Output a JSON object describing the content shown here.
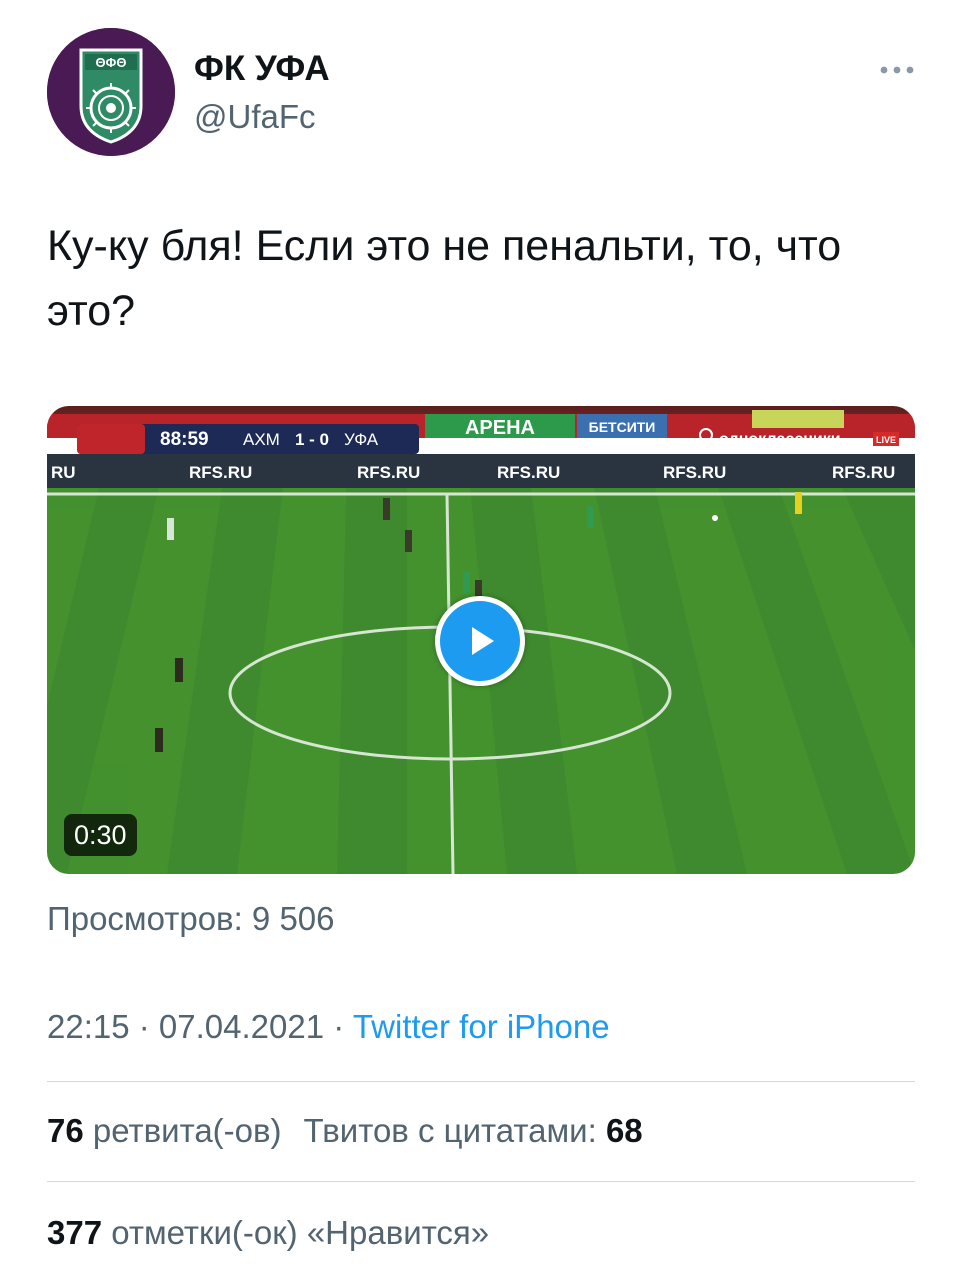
{
  "tweet": {
    "display_name": "ФК УФА",
    "handle": "@UfaFc",
    "text": "Ку-ку бля! Если это не пенальти, то, что это?",
    "views": "Просмотров: 9 506",
    "time": "22:15",
    "date": "07.04.2021",
    "source": "Twitter for iPhone",
    "retweets_count": "76",
    "retweets_label": "ретвита(-ов)",
    "quotes_label": "Твитов с цитатами:",
    "quotes_count": "68",
    "likes_count": "377",
    "likes_label": "отметки(-ок) «Нравится»"
  },
  "video": {
    "duration": "0:30",
    "scoreboard": {
      "time": "88:59",
      "home": "АХМ",
      "score": "1 - 0",
      "away": "УФА"
    },
    "broadcaster": "одноклассники",
    "live": "LIVE",
    "board_text": "RFS.RU",
    "arena_text": "АРЕНА",
    "sponsor_text": "БЕТСИТИ"
  },
  "colors": {
    "accent": "#1d9bf0",
    "secondary_text": "#536471",
    "avatar_bg": "#4a1a54",
    "pitch": "#3f8a2e"
  },
  "icons": {
    "more": "more-horizontal-icon",
    "play": "play-icon",
    "logo": "fc-ufa-logo"
  }
}
